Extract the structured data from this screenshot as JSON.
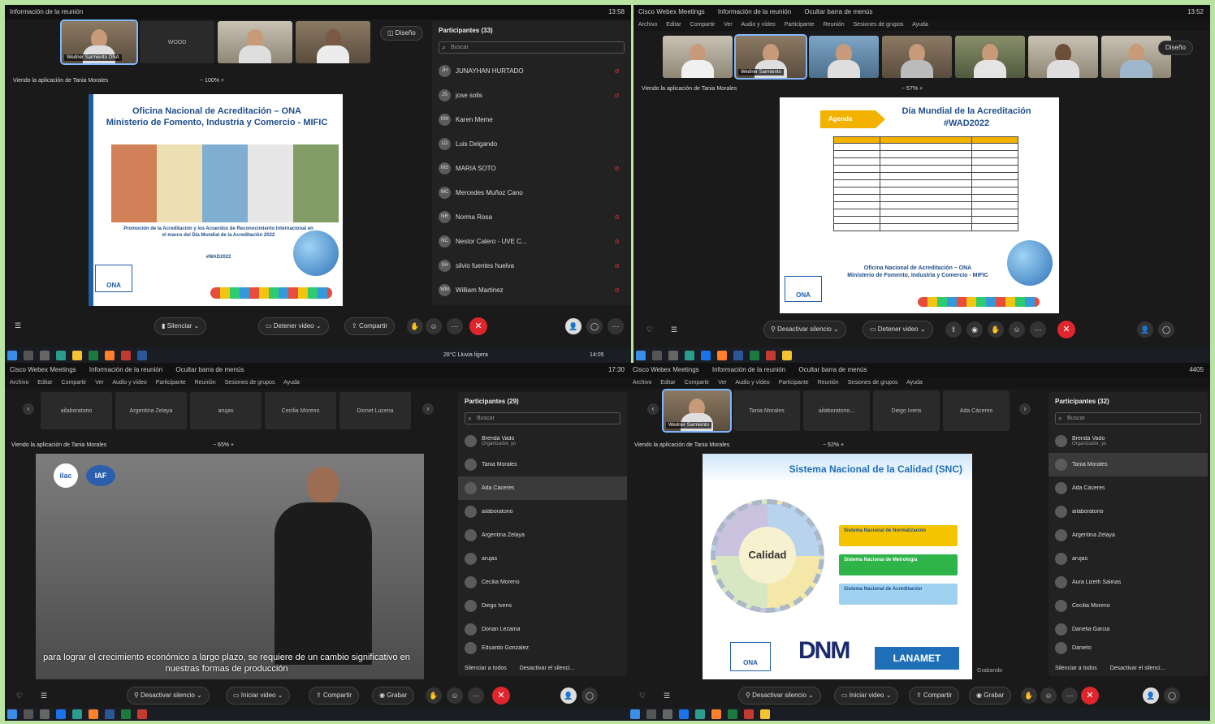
{
  "q1": {
    "window_title": "Información de la reunión",
    "clock": "13:58",
    "thumbs": [
      {
        "name": "Wedner Sarmiento ONA"
      },
      {
        "name": "WOOD"
      },
      {
        "name": ""
      },
      {
        "name": ""
      }
    ],
    "design_button": "Diseño",
    "viewing_label": "Viendo la aplicación de Tania Morales",
    "zoom_label": "100%",
    "slide": {
      "title_line1": "Oficina Nacional de Acreditación – ONA",
      "title_line2": "Ministerio de Fomento, Industria y Comercio - MIFIC",
      "body": "Promoción de la Acreditación y los Acuerdos de Reconocimiento Internacional en el marco del Día Mundial de la Acreditación 2022",
      "hashtag": "#WAD2022",
      "logo_text": "ONA"
    },
    "participants_panel": {
      "title": "Participantes (33)",
      "search_placeholder": "Buscar",
      "rows": [
        {
          "initials": "JH",
          "name": "JUNAYHAN HURTADO"
        },
        {
          "initials": "JS",
          "name": "jose solis"
        },
        {
          "initials": "KM",
          "name": "Karen Meme"
        },
        {
          "initials": "LD",
          "name": "Luis Delgando"
        },
        {
          "initials": "MS",
          "name": "MARIA SOTO"
        },
        {
          "initials": "MC",
          "name": "Mercedes Muñoz Cano"
        },
        {
          "initials": "NR",
          "name": "Norma Rosa"
        },
        {
          "initials": "NC",
          "name": "Nestor Calero - UVE C..."
        },
        {
          "initials": "SH",
          "name": "silvio fuentes huelva"
        },
        {
          "initials": "WM",
          "name": "William Martinez"
        }
      ]
    },
    "controls": {
      "mute": "Silenciar",
      "video": "Detener video",
      "share": "Compartir"
    }
  },
  "q2": {
    "window_title": "Cisco Webex Meetings",
    "tab_info": "Información de la reunión",
    "tab_hide": "Ocultar barra de menús",
    "clock": "13:52",
    "menu": [
      "Archivo",
      "Editar",
      "Compartir",
      "Ver",
      "Audio y vídeo",
      "Participante",
      "Reunión",
      "Sesiones de grupos",
      "Ayuda"
    ],
    "thumb_nametag": "Wedner Sarmiento",
    "design_button": "Diseño",
    "viewing_label": "Viendo la aplicación de Tania Morales",
    "zoom_label": "57%",
    "slide": {
      "badge": "Agenda",
      "title_line1": "Día Mundial de la Acreditación",
      "title_line2": "#WAD2022",
      "footer1": "Oficina Nacional de Acreditación – ONA",
      "footer2": "Ministerio de Fomento, Industria y Comercio - MIFIC",
      "logo_text": "ONA"
    },
    "controls": {
      "unmute": "Desactivar silencio",
      "video": "Detener video"
    }
  },
  "q3": {
    "window_title": "Cisco Webex Meetings",
    "tab_info": "Información de la reunión",
    "tab_hide": "Ocultar barra de menús",
    "clock": "17:30",
    "menu": [
      "Archivo",
      "Editar",
      "Compartir",
      "Ver",
      "Audio y vídeo",
      "Participante",
      "Reunión",
      "Sesiones de grupos",
      "Ayuda"
    ],
    "thumbs": [
      "ailaboratorio",
      "Argentina Zelaya",
      "arujas",
      "Cecilia Moreno",
      "Dionet Lucena"
    ],
    "viewing_label": "Viendo la aplicación de Tania Morales",
    "zoom_label": "65%",
    "video_logos": [
      "ilac",
      "IAF"
    ],
    "caption": "para lograr el crecimiento económico a largo plazo, se requiere de un cambio significativo en nuestras formas de producción",
    "participants_panel": {
      "title": "Participantes (29)",
      "search_placeholder": "Buscar",
      "rows": [
        {
          "name": "Brenda Vado",
          "sub": "Organizador, yo"
        },
        {
          "name": "Tania Morales",
          "sub": ""
        },
        {
          "name": "Ada Cáceres",
          "sub": ""
        },
        {
          "name": "ailaboratorio",
          "sub": ""
        },
        {
          "name": "Argentina Zelaya",
          "sub": ""
        },
        {
          "name": "arujas",
          "sub": ""
        },
        {
          "name": "Cecilia Moreno",
          "sub": ""
        },
        {
          "name": "Diego Ivens",
          "sub": ""
        },
        {
          "name": "Dorian Lezama",
          "sub": ""
        },
        {
          "name": "Eduardo Gonzalez",
          "sub": ""
        }
      ],
      "footer_mute_all": "Silenciar a todos",
      "footer_unmute_all": "Desactivar el silenci..."
    },
    "controls": {
      "unmute": "Desactivar silencio",
      "video": "Iniciar video",
      "share": "Compartir",
      "record": "Grabar"
    }
  },
  "q4": {
    "window_title": "Cisco Webex Meetings",
    "tab_info": "Información de la reunión",
    "tab_hide": "Ocultar barra de menús",
    "clock": "4405",
    "menu": [
      "Archivo",
      "Editar",
      "Compartir",
      "Ver",
      "Audio y vídeo",
      "Participante",
      "Reunión",
      "Sesiones de grupos",
      "Ayuda"
    ],
    "thumb_nametag": "Wedner Sarmiento",
    "thumbs": [
      "Tania Morales",
      "ailaboratorio...",
      "Diego Ivens",
      "Ada Cáceres"
    ],
    "viewing_label": "Viendo la aplicación de Tania Morales",
    "zoom_label": "52%",
    "slide": {
      "title": "Sistema Nacional de la Calidad (SNC)",
      "center": "Calidad",
      "item1": "Sistema Nacional de Normalización",
      "item2": "Sistema Nacional de Metrología",
      "item3": "Sistema Nacional de Acreditación",
      "logo1": "ONA",
      "logo2": "DNM",
      "logo3": "LANAMET"
    },
    "recording_label": "Grabando",
    "participants_panel": {
      "title": "Participantes (32)",
      "search_placeholder": "Buscar",
      "rows": [
        {
          "name": "Brenda Vado",
          "sub": "Organizador, yo"
        },
        {
          "name": "Tania Morales",
          "sub": ""
        },
        {
          "name": "Ada Cáceres",
          "sub": ""
        },
        {
          "name": "ailaboratorio",
          "sub": ""
        },
        {
          "name": "Argentina Zelaya",
          "sub": ""
        },
        {
          "name": "arujas",
          "sub": ""
        },
        {
          "name": "Aura Lizeth Salinas",
          "sub": ""
        },
        {
          "name": "Cecilia Moreno",
          "sub": ""
        },
        {
          "name": "Danelia Garcia",
          "sub": ""
        },
        {
          "name": "Danielo",
          "sub": ""
        }
      ],
      "footer_mute_all": "Silenciar a todos",
      "footer_unmute_all": "Desactivar el silenci..."
    },
    "controls": {
      "unmute": "Desactivar silencio",
      "video": "Iniciar video",
      "share": "Compartir",
      "record": "Grabar"
    }
  },
  "taskbar_top": {
    "weather": "28°C Lluvia ligera",
    "time": "14:05"
  },
  "colors": {
    "background": "#b9e3a3",
    "end_call": "#e0262d",
    "accent": "#7fb6ff"
  }
}
